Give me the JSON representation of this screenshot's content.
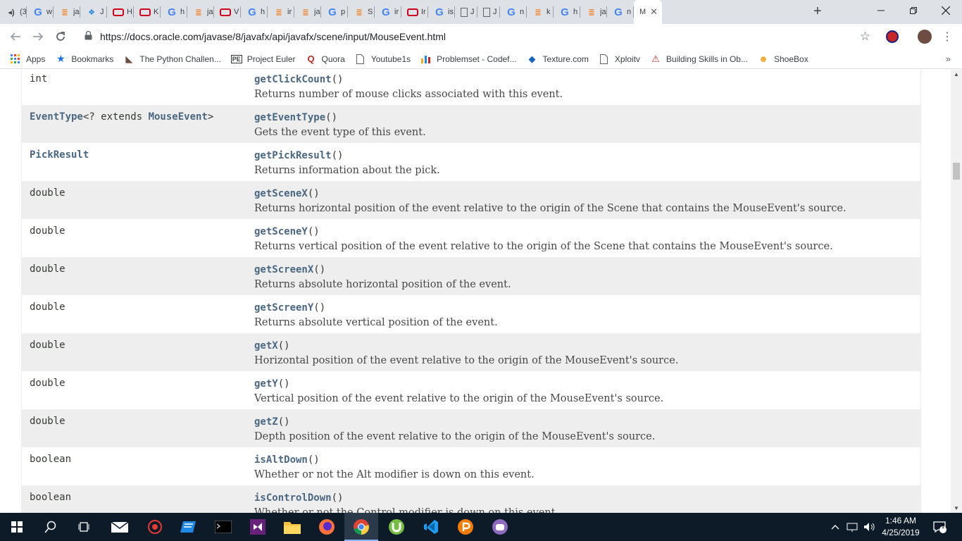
{
  "browser": {
    "tabs": [
      {
        "icon": "speaker-icon",
        "title": "(3"
      },
      {
        "icon": "google-icon",
        "title": "w"
      },
      {
        "icon": "stackoverflow-icon",
        "title": "ja"
      },
      {
        "icon": "kotlin-icon",
        "title": "J"
      },
      {
        "icon": "oracle-icon",
        "title": "H"
      },
      {
        "icon": "oracle-icon",
        "title": "K"
      },
      {
        "icon": "google-icon",
        "title": "h"
      },
      {
        "icon": "stackoverflow-icon",
        "title": "ja"
      },
      {
        "icon": "oracle-icon",
        "title": "V"
      },
      {
        "icon": "google-icon",
        "title": "h"
      },
      {
        "icon": "stackoverflow-icon",
        "title": "ir"
      },
      {
        "icon": "stackoverflow-icon",
        "title": "ja"
      },
      {
        "icon": "google-icon",
        "title": "p"
      },
      {
        "icon": "stackoverflow-icon",
        "title": "S"
      },
      {
        "icon": "google-icon",
        "title": "ir"
      },
      {
        "icon": "oracle-icon",
        "title": "Ir"
      },
      {
        "icon": "google-icon",
        "title": "is"
      },
      {
        "icon": "document-icon",
        "title": "J"
      },
      {
        "icon": "document-icon",
        "title": "J"
      },
      {
        "icon": "google-icon",
        "title": "n"
      },
      {
        "icon": "stackoverflow-icon",
        "title": "k"
      },
      {
        "icon": "google-icon",
        "title": "h"
      },
      {
        "icon": "stackoverflow-icon",
        "title": "ja"
      },
      {
        "icon": "google-icon",
        "title": "n"
      }
    ],
    "active_tab": {
      "title": "M",
      "close": "✕"
    },
    "new_tab": "+",
    "url": "https://docs.oracle.com/javase/8/javafx/api/javafx/scene/input/MouseEvent.html"
  },
  "bookmarks": [
    {
      "label": "Apps",
      "icon": "apps-grid-icon"
    },
    {
      "label": "Bookmarks",
      "icon": "star-icon"
    },
    {
      "label": "The Python Challen...",
      "icon": "python-challenge-icon"
    },
    {
      "label": "Project Euler",
      "icon": "project-euler-icon"
    },
    {
      "label": "Quora",
      "icon": "quora-icon"
    },
    {
      "label": "Youtube1s",
      "icon": "document-icon"
    },
    {
      "label": "Problemset - Codef...",
      "icon": "codeforces-icon"
    },
    {
      "label": "Texture.com",
      "icon": "texture-icon"
    },
    {
      "label": "Xploitv",
      "icon": "document-icon"
    },
    {
      "label": "Building Skills in Ob...",
      "icon": "building-skills-icon"
    },
    {
      "label": "ShoeBox",
      "icon": "shoebox-icon"
    }
  ],
  "bookmarks_more": "»",
  "methods": [
    {
      "type": "int",
      "type_link": "",
      "type_rest": "",
      "name": "getClickCount",
      "desc": "Returns number of mouse clicks associated with this event."
    },
    {
      "type": "",
      "type_link": "EventType",
      "type_rest": "<? extends ",
      "type_link2": "MouseEvent",
      "type_end": ">",
      "name": "getEventType",
      "desc": "Gets the event type of this event."
    },
    {
      "type": "",
      "type_link": "PickResult",
      "type_rest": "",
      "name": "getPickResult",
      "desc": "Returns information about the pick."
    },
    {
      "type": "double",
      "type_link": "",
      "type_rest": "",
      "name": "getSceneX",
      "desc": "Returns horizontal position of the event relative to the origin of the Scene that contains the MouseEvent's source."
    },
    {
      "type": "double",
      "type_link": "",
      "type_rest": "",
      "name": "getSceneY",
      "desc": "Returns vertical position of the event relative to the origin of the Scene that contains the MouseEvent's source."
    },
    {
      "type": "double",
      "type_link": "",
      "type_rest": "",
      "name": "getScreenX",
      "desc": "Returns absolute horizontal position of the event."
    },
    {
      "type": "double",
      "type_link": "",
      "type_rest": "",
      "name": "getScreenY",
      "desc": "Returns absolute vertical position of the event."
    },
    {
      "type": "double",
      "type_link": "",
      "type_rest": "",
      "name": "getX",
      "desc": "Horizontal position of the event relative to the origin of the MouseEvent's source."
    },
    {
      "type": "double",
      "type_link": "",
      "type_rest": "",
      "name": "getY",
      "desc": "Vertical position of the event relative to the origin of the MouseEvent's source."
    },
    {
      "type": "double",
      "type_link": "",
      "type_rest": "",
      "name": "getZ",
      "desc": "Depth position of the event relative to the origin of the MouseEvent's source."
    },
    {
      "type": "boolean",
      "type_link": "",
      "type_rest": "",
      "name": "isAltDown",
      "desc": "Whether or not the Alt modifier is down on this event."
    },
    {
      "type": "boolean",
      "type_link": "",
      "type_rest": "",
      "name": "isControlDown",
      "desc": "Whether or not the Control modifier is down on this event."
    }
  ],
  "method_parens": "()",
  "taskbar": {
    "apps": [
      "start-icon",
      "search-icon",
      "task-view-icon",
      "mail-icon",
      "app-icon",
      "app-icon",
      "terminal-icon",
      "visual-studio-icon",
      "file-explorer-icon",
      "firefox-icon",
      "chrome-icon",
      "utorrent-icon",
      "vscode-icon",
      "app-icon",
      "app-icon"
    ],
    "time": "1:46 AM",
    "date": "4/25/2019",
    "notification_count": "1"
  },
  "colors": {
    "link": "#4a6782",
    "row_alt": "#eeeeef",
    "taskbar": "#0d1a27"
  }
}
